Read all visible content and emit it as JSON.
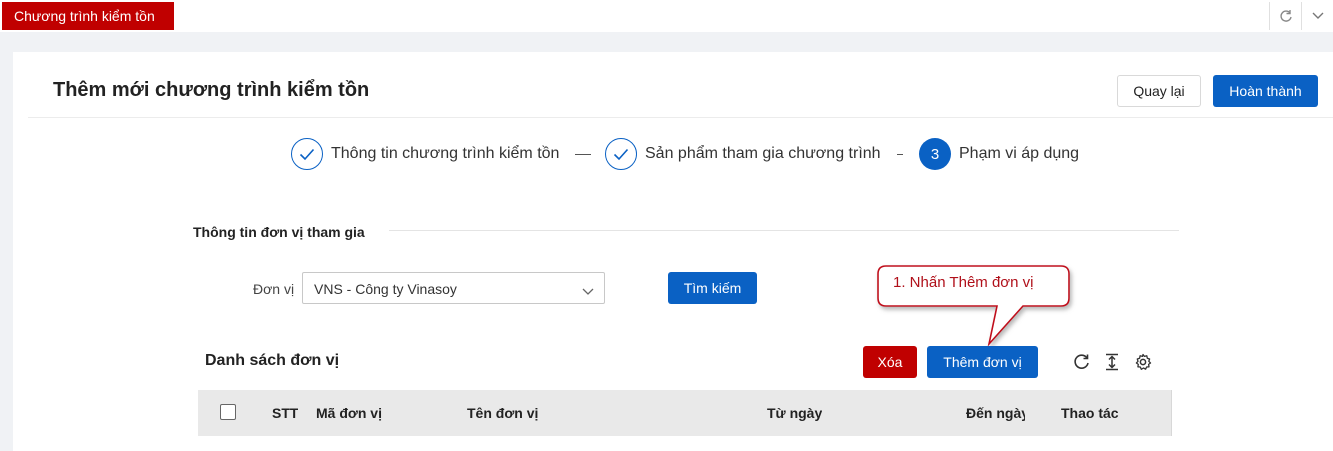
{
  "app_tab": "Chương trình kiểm tồn",
  "page": {
    "title": "Thêm mới chương trình kiểm tồn",
    "back_label": "Quay lại",
    "finish_label": "Hoàn thành"
  },
  "steps": [
    {
      "label": "Thông tin chương trình kiểm tồn",
      "state": "done"
    },
    {
      "label": "Sản phẩm tham gia chương trình",
      "state": "done"
    },
    {
      "number": "3",
      "label": "Phạm vi áp dụng",
      "state": "active"
    }
  ],
  "section_title": "Thông tin đơn vị tham gia",
  "filter": {
    "label": "Đơn vị",
    "selected": "VNS - Công ty Vinasoy",
    "search_label": "Tìm kiếm"
  },
  "list": {
    "title": "Danh sách đơn vị",
    "delete_label": "Xóa",
    "add_label": "Thêm đơn vị",
    "columns": [
      "STT",
      "Mã đơn vị",
      "Tên đơn vị",
      "Từ ngày",
      "Đến ngày",
      "Thao tác"
    ]
  },
  "callout": "1. Nhấn Thêm đơn vị",
  "colors": {
    "primary": "#0a61c4",
    "danger": "#c00000",
    "callout_text": "#b0101a"
  },
  "icons": [
    "refresh-icon",
    "chevron-down-icon",
    "check-icon",
    "caret-down-icon",
    "column-height-icon",
    "settings-icon"
  ]
}
